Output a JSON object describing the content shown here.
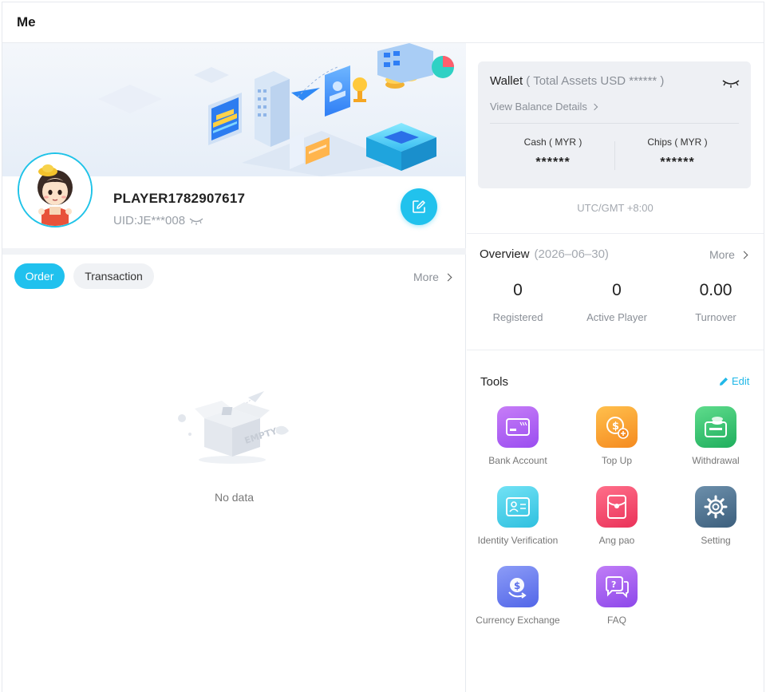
{
  "header": {
    "title": "Me"
  },
  "profile": {
    "player_name": "PLAYER1782907617",
    "uid": "UID:JE***008"
  },
  "tabs": {
    "order": "Order",
    "transaction": "Transaction",
    "more": "More"
  },
  "empty": {
    "illustration_text": "EMPTY",
    "message": "No data"
  },
  "wallet": {
    "title": "Wallet",
    "subtitle": "( Total Assets USD  ****** )",
    "balance_link": "View Balance Details",
    "cash_label": "Cash ( MYR )",
    "cash_value": "******",
    "chips_label": "Chips ( MYR )",
    "chips_value": "******"
  },
  "timezone": "UTC/GMT +8:00",
  "overview": {
    "title": "Overview",
    "date": "(2026–06–30)",
    "more": "More",
    "stats": [
      {
        "value": "0",
        "label": "Registered"
      },
      {
        "value": "0",
        "label": "Active Player"
      },
      {
        "value": "0.00",
        "label": "Turnover"
      }
    ]
  },
  "tools": {
    "title": "Tools",
    "edit": "Edit",
    "items": [
      {
        "label": "Bank Account",
        "icon": "bank-card-icon",
        "color": "#a95cf0"
      },
      {
        "label": "Top Up",
        "icon": "top-up-coin-icon",
        "color": "#f79a2c"
      },
      {
        "label": "Withdrawal",
        "icon": "withdrawal-wallet-icon",
        "color": "#2fbf6d"
      },
      {
        "label": "Identity Verification",
        "icon": "id-card-icon",
        "color": "#3ccbe6"
      },
      {
        "label": "Ang pao",
        "icon": "red-envelope-icon",
        "color": "#f0486e"
      },
      {
        "label": "Setting",
        "icon": "gear-icon",
        "color": "#4a6f8c"
      },
      {
        "label": "Currency Exchange",
        "icon": "currency-exchange-icon",
        "color": "#6a7ef0"
      },
      {
        "label": "FAQ",
        "icon": "faq-chat-icon",
        "color": "#a25cf0"
      }
    ]
  },
  "colors": {
    "accent": "#21c2ed",
    "card_bg": "#eef0f4",
    "muted_text": "#8a8f97"
  }
}
